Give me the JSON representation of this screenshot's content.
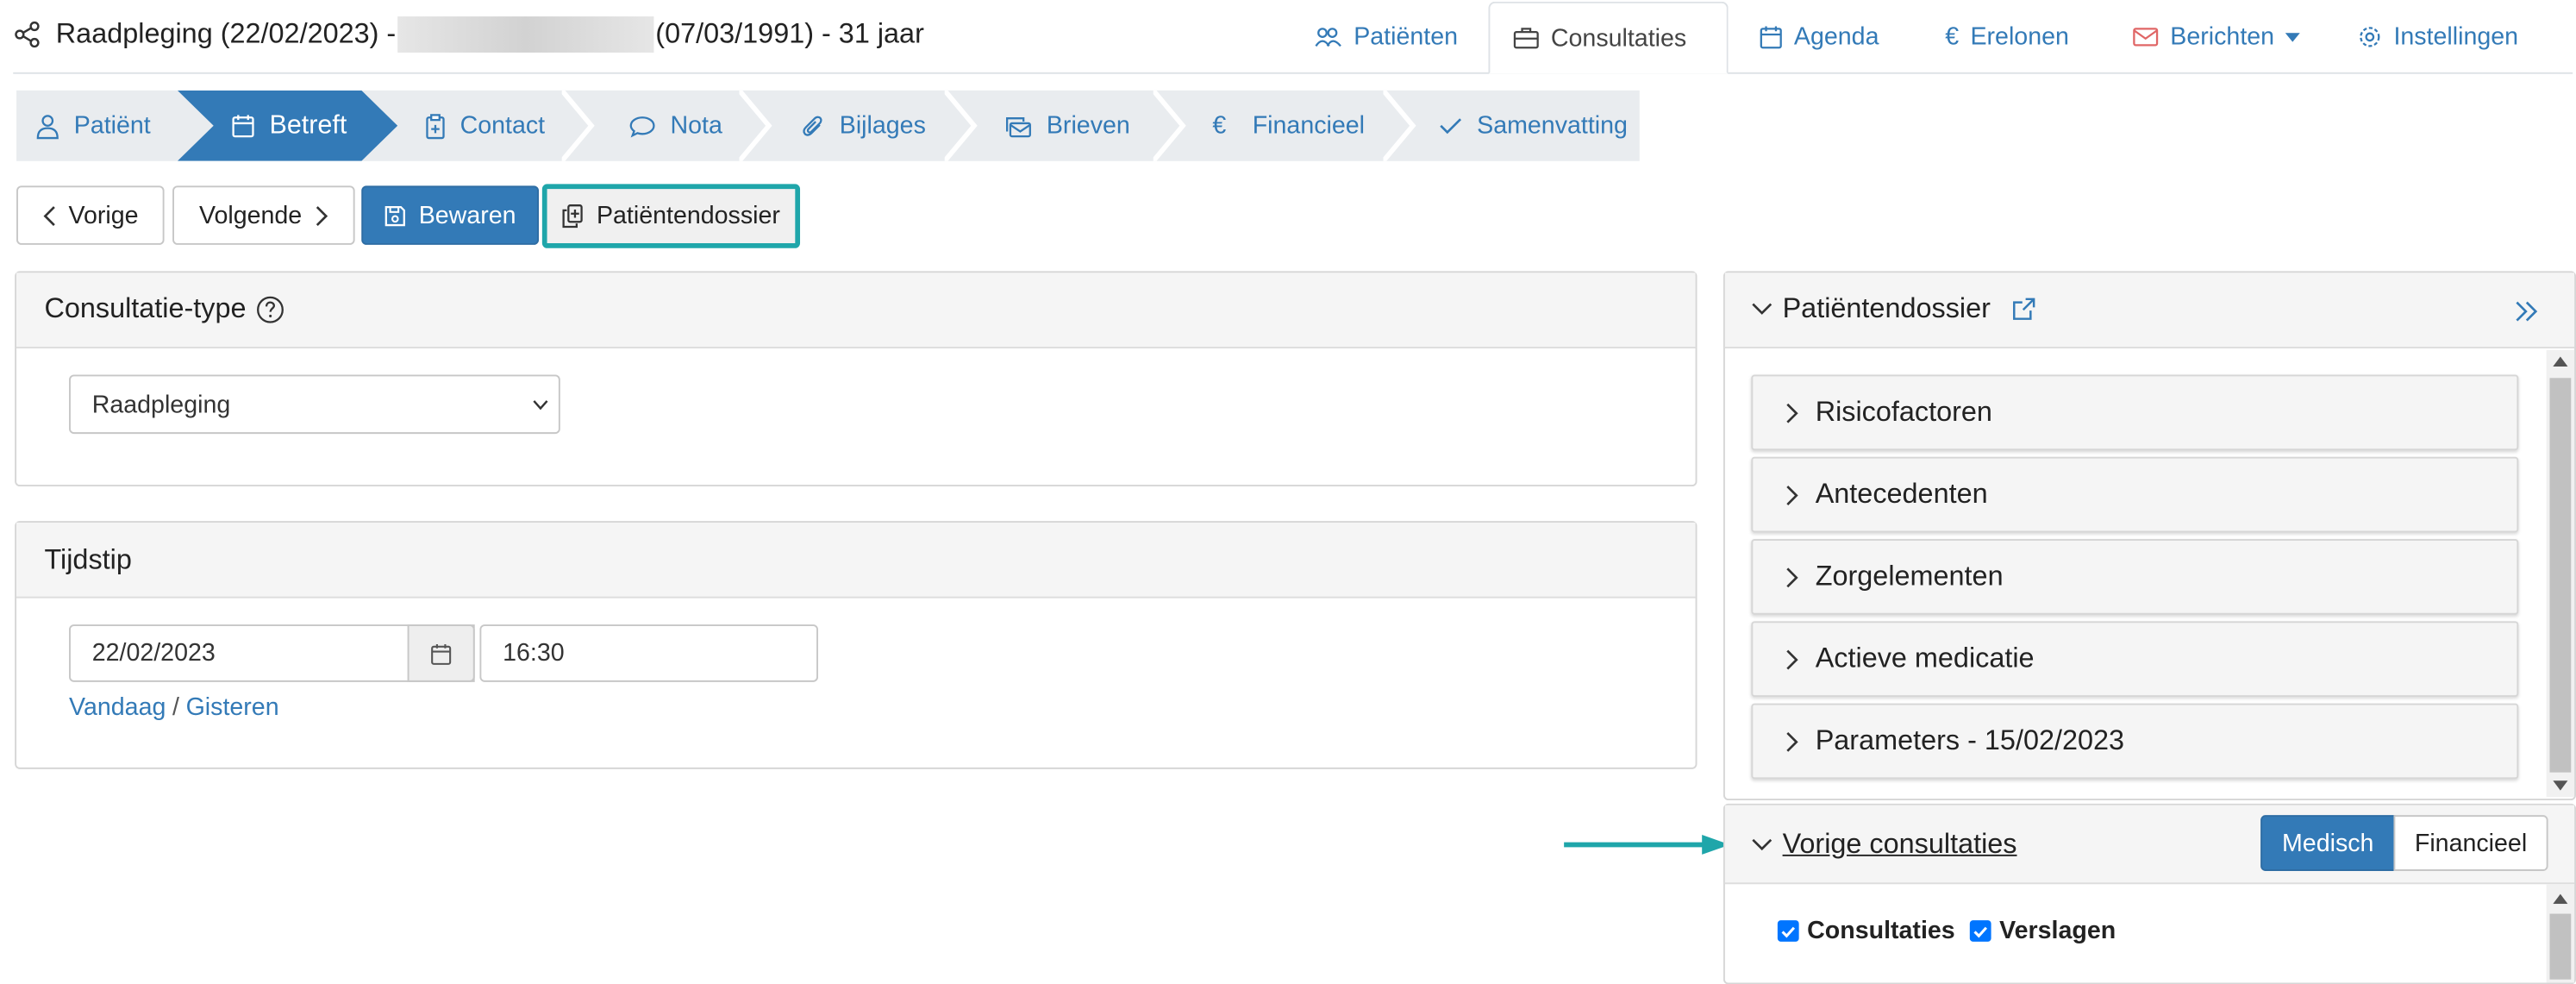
{
  "header": {
    "title_prefix": "Raadpleging (22/02/2023) -",
    "title_suffix": "(07/03/1991) - 31 jaar",
    "nav": [
      {
        "label": "Patiënten"
      },
      {
        "label": "Consultaties"
      },
      {
        "label": "Agenda"
      },
      {
        "label": "Erelonen"
      },
      {
        "label": "Berichten"
      },
      {
        "label": "Instellingen"
      }
    ]
  },
  "wizard": {
    "steps": [
      {
        "label": "Patiënt"
      },
      {
        "label": "Betreft"
      },
      {
        "label": "Contact"
      },
      {
        "label": "Nota"
      },
      {
        "label": "Bijlages"
      },
      {
        "label": "Brieven"
      },
      {
        "label": "Financieel"
      },
      {
        "label": "Samenvatting"
      }
    ]
  },
  "actions": {
    "prev": "Vorige",
    "next": "Volgende",
    "save": "Bewaren",
    "dossier": "Patiëntendossier"
  },
  "consult_type": {
    "title": "Consultatie-type",
    "selected": "Raadpleging"
  },
  "time": {
    "title": "Tijdstip",
    "date": "22/02/2023",
    "hour": "16:30",
    "today": "Vandaag",
    "separator": "/",
    "yesterday": "Gisteren"
  },
  "dossier_panel": {
    "title": "Patiëntendossier",
    "items": [
      {
        "label": "Risicofactoren"
      },
      {
        "label": "Antecedenten"
      },
      {
        "label": "Zorgelementen"
      },
      {
        "label": "Actieve medicatie"
      },
      {
        "label": "Parameters - 15/02/2023"
      }
    ]
  },
  "previous_panel": {
    "title": "Vorige consultaties",
    "seg_medical": "Medisch",
    "seg_financial": "Financieel",
    "cb_consultations": "Consultaties",
    "cb_reports": "Verslagen"
  },
  "colors": {
    "primary": "#337ab7",
    "highlight": "#1fa6aa",
    "checkbox": "#0075ff"
  }
}
